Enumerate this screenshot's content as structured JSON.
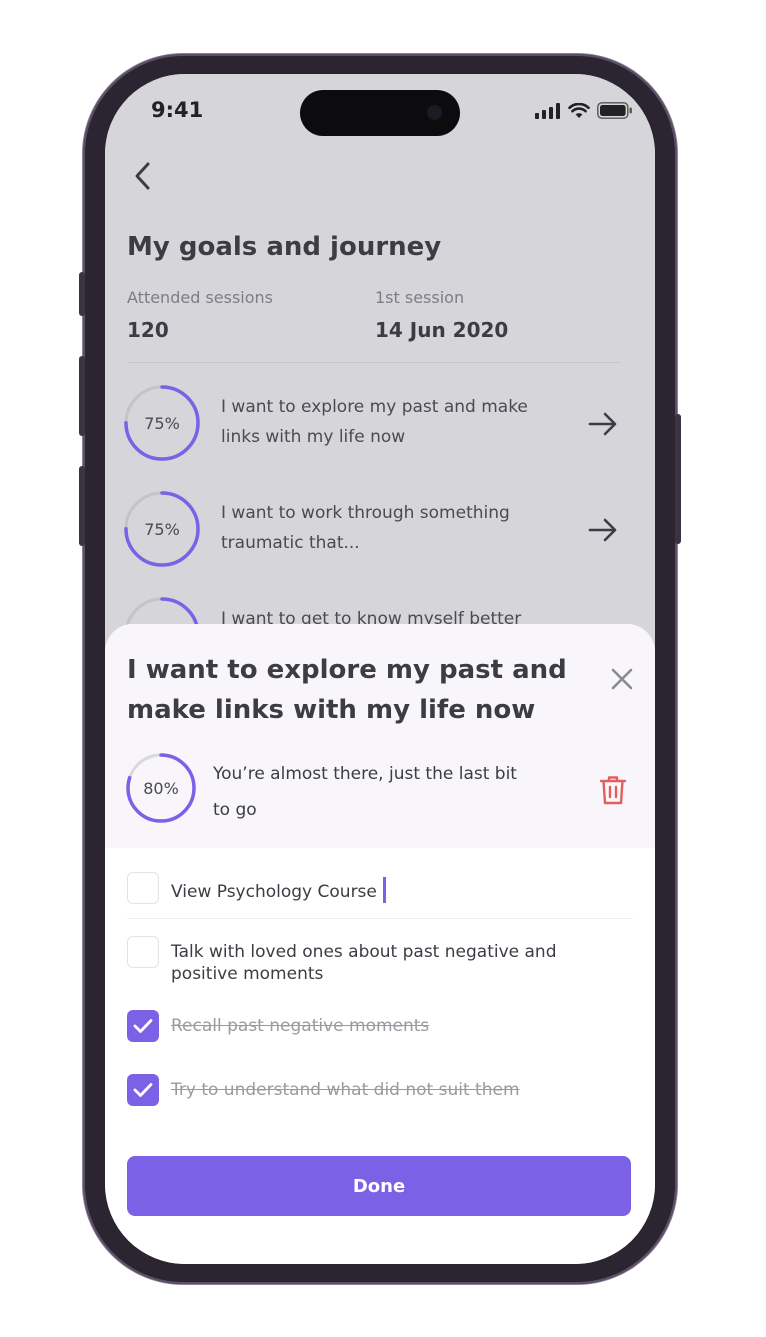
{
  "status_bar": {
    "time": "9:41"
  },
  "header": {
    "title": "My goals and journey",
    "stats": [
      {
        "label": "Attended sessions",
        "value": "120"
      },
      {
        "label": "1st session",
        "value": "14 Jun 2020"
      }
    ]
  },
  "goals": [
    {
      "progress_label": "75%",
      "progress": 0.75,
      "text": "I want to explore my past and make links with my life now"
    },
    {
      "progress_label": "75%",
      "progress": 0.75,
      "text": "I want to work through something traumatic that..."
    },
    {
      "progress_label": "",
      "progress": 0.5,
      "text": "I want to get to know myself better"
    }
  ],
  "sheet": {
    "title": "I want to explore my past and make links with my life now",
    "progress_label": "80%",
    "progress": 0.8,
    "message": "You’re almost there, just the last bit to go",
    "tasks": [
      {
        "label": "View Psychology Course",
        "checked": false
      },
      {
        "label": "Talk with loved ones about past negative and positive moments",
        "checked": false
      },
      {
        "label": "Recall past negative moments",
        "checked": true
      },
      {
        "label": "Try to understand what did not suit them",
        "checked": true
      }
    ],
    "done_label": "Done"
  },
  "colors": {
    "accent": "#7b61e6",
    "danger": "#e0605c",
    "backdrop": "#d5d5da",
    "sheet_header": "#f8f6fb"
  },
  "icons": [
    "back-arrow-icon",
    "arrow-right-icon",
    "close-icon",
    "trash-icon",
    "check-icon",
    "signal-icon",
    "wifi-icon",
    "battery-icon"
  ]
}
